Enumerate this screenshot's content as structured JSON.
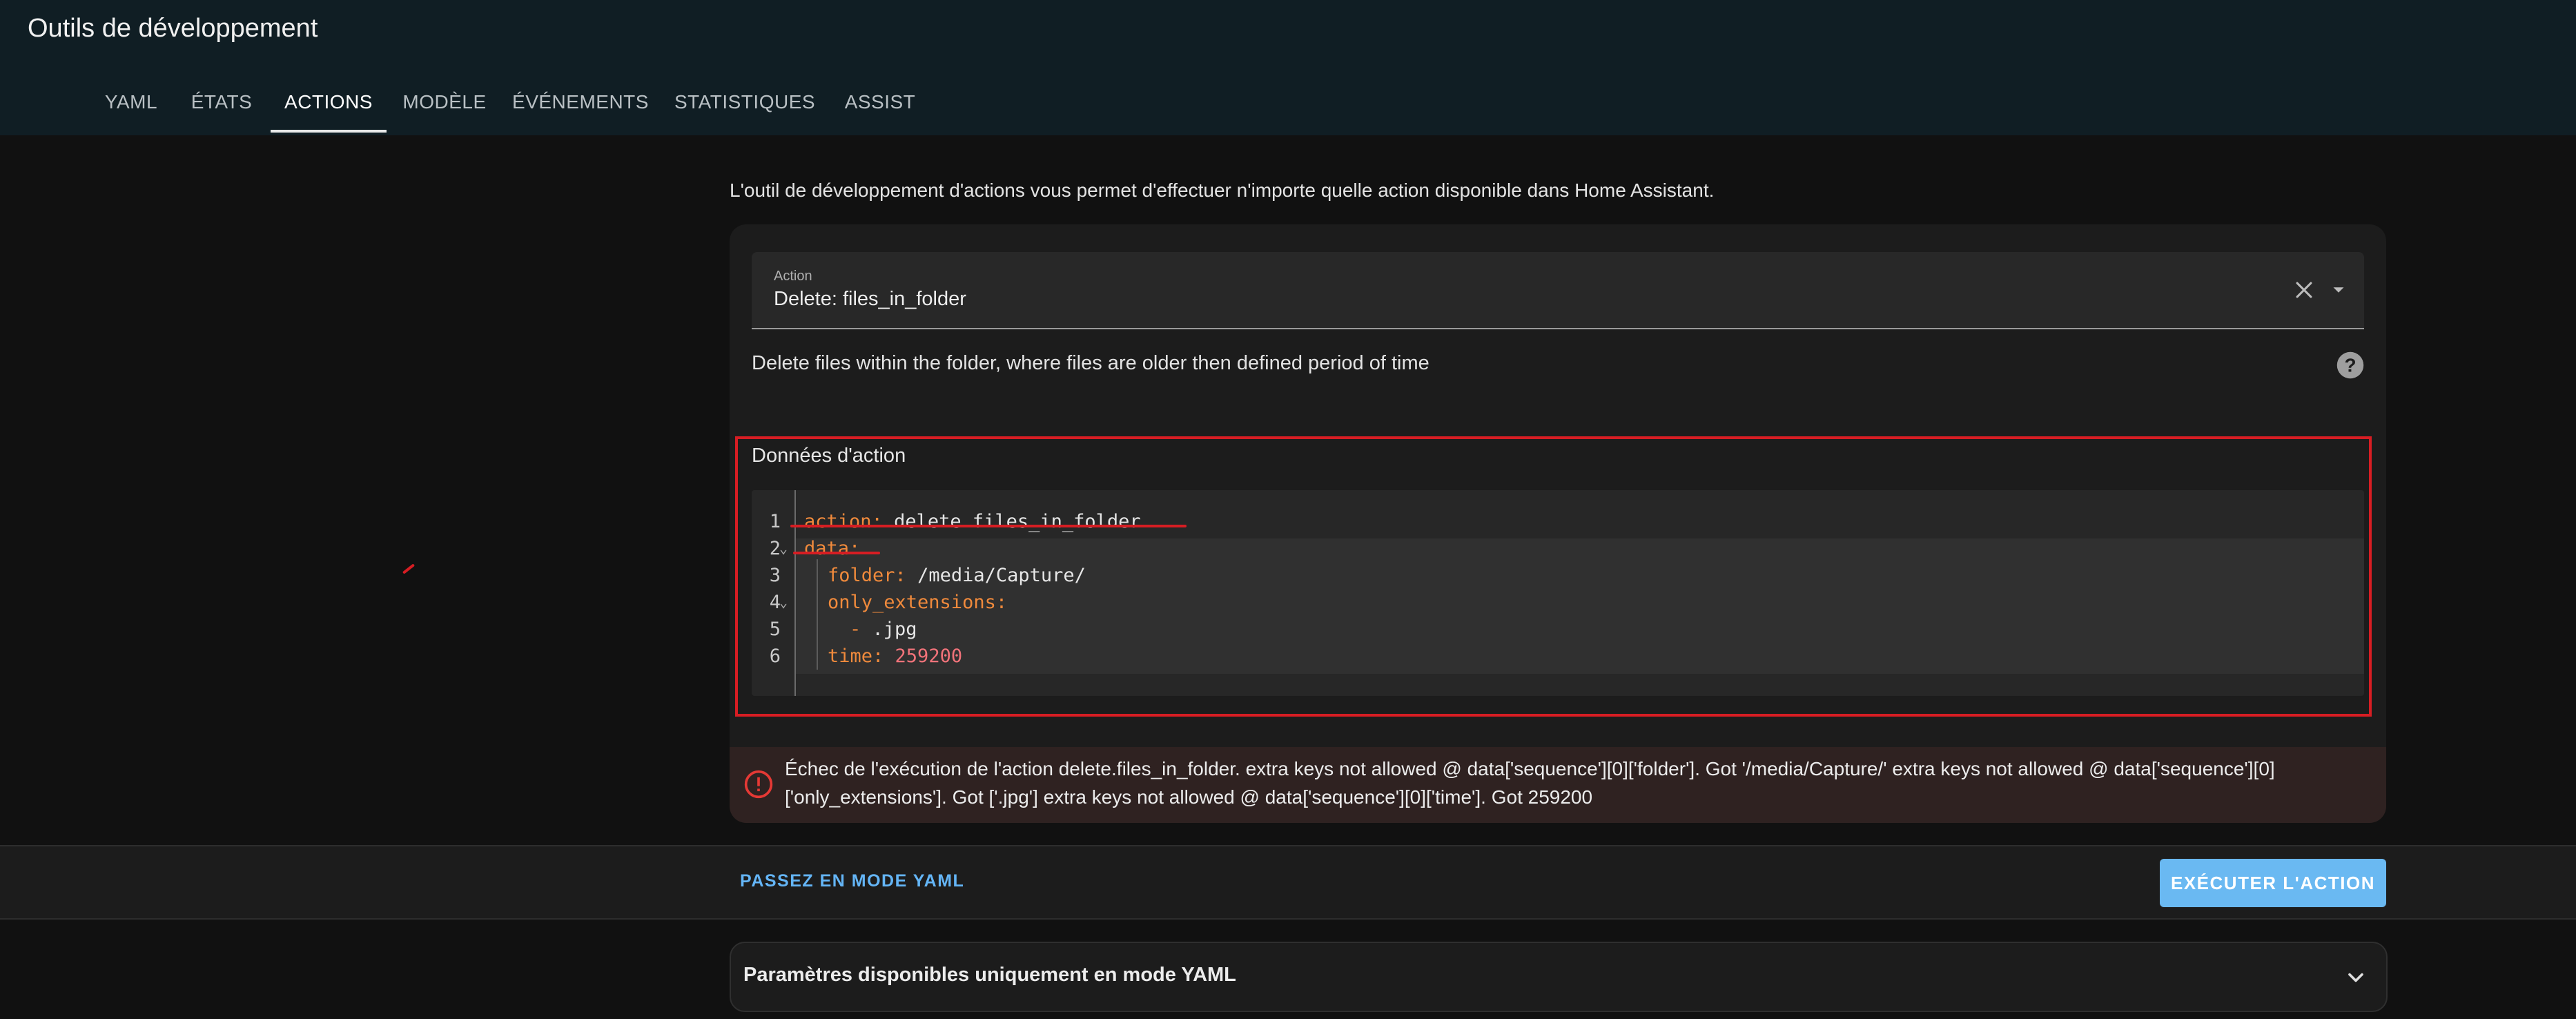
{
  "header": {
    "title": "Outils de développement",
    "tabs": [
      {
        "label": "YAML",
        "active": false
      },
      {
        "label": "ÉTATS",
        "active": false
      },
      {
        "label": "ACTIONS",
        "active": true
      },
      {
        "label": "MODÈLE",
        "active": false
      },
      {
        "label": "ÉVÉNEMENTS",
        "active": false
      },
      {
        "label": "STATISTIQUES",
        "active": false
      },
      {
        "label": "ASSIST",
        "active": false
      }
    ]
  },
  "main": {
    "intro": "L'outil de développement d'actions vous permet d'effectuer n'importe quelle action disponible dans Home Assistant.",
    "action_field": {
      "label": "Action",
      "value": "Delete: files_in_folder"
    },
    "action_description": "Delete files within the folder, where files are older then defined period of time",
    "data_title": "Données d'action",
    "code_lines": [
      {
        "num": "1",
        "key": "action",
        "value": "delete.files_in_folder"
      },
      {
        "num": "2",
        "key": "data",
        "value": ""
      },
      {
        "num": "3",
        "key": "folder",
        "value": "/media/Capture/"
      },
      {
        "num": "4",
        "key": "only_extensions",
        "value": ""
      },
      {
        "num": "5",
        "key": "-",
        "value": ".jpg"
      },
      {
        "num": "6",
        "key": "time",
        "value": "259200"
      }
    ],
    "error": {
      "line1": "Échec de l'exécution de l'action delete.files_in_folder. extra keys not allowed @ data['sequence'][0]['folder']. Got '/media/Capture/' extra keys not allowed @ data['sequence'][0]",
      "line2": "['only_extensions']. Got ['.jpg'] extra keys not allowed @ data['sequence'][0]['time']. Got 259200"
    }
  },
  "footer": {
    "yaml_mode_label": "PASSEZ EN MODE YAML",
    "execute_label": "EXÉCUTER L'ACTION"
  },
  "yaml_only_panel": {
    "label": "Paramètres disponibles uniquement en mode YAML"
  },
  "colors": {
    "header_bg": "#101e24",
    "page_bg": "#111111",
    "accent_blue": "#64b5f6",
    "error_red": "#e53935",
    "highlight_red": "#d71d23",
    "yaml_key": "#f08a3c",
    "yaml_number": "#f2737a"
  },
  "icons": {
    "clear": "close-icon",
    "dropdown": "arrow-drop-down-icon",
    "help": "help-circle-icon",
    "error": "alert-circle-icon",
    "expand": "chevron-down-icon"
  }
}
